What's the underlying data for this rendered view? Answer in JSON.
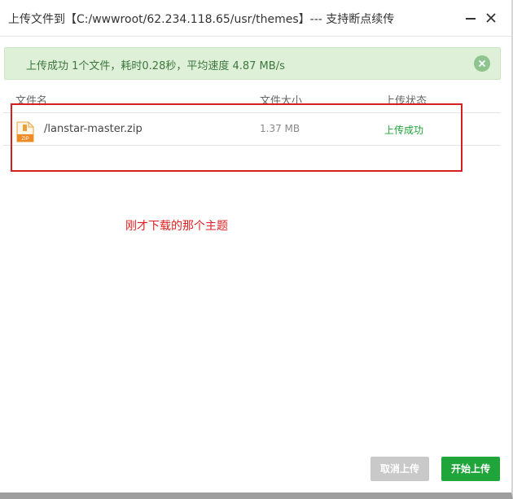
{
  "window": {
    "title": "上传文件到【C:/wwwroot/62.234.118.65/usr/themes】--- 支持断点续传",
    "minimize_icon": "minimize-icon",
    "close_icon": "close-icon"
  },
  "alert": {
    "message": "上传成功 1个文件，耗时0.28秒，平均速度 4.87 MB/s",
    "close_icon": "circle-close-icon"
  },
  "table": {
    "headers": [
      "文件名",
      "文件大小",
      "上传状态"
    ],
    "rows": [
      {
        "icon": "zip-file-icon",
        "name": "/lanstar-master.zip",
        "size": "1.37 MB",
        "status": "上传成功"
      }
    ]
  },
  "annotation": {
    "text": "刚才下载的那个主题"
  },
  "buttons": {
    "cancel": "取消上传",
    "start": "开始上传"
  },
  "colors": {
    "accent_green": "#20a53a",
    "alert_bg": "#dff0d8",
    "alert_text": "#3c763d",
    "annotation_red": "#e02020",
    "button_disabled": "#c9c9c9"
  }
}
